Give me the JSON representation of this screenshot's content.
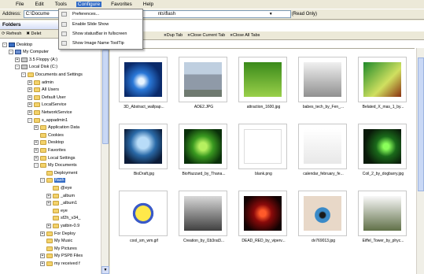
{
  "menubar": [
    "File",
    "Edit",
    "Tools",
    "Configure",
    "Favorites",
    "Help"
  ],
  "address": {
    "label": "Address:",
    "value_left": "C:\\Docume",
    "value_right": "nts\\flash",
    "readonly": "(Read Only)"
  },
  "left_panel": {
    "title": "Folders",
    "refresh": "Refresh",
    "delete": "Delet"
  },
  "tree": [
    {
      "label": "Desktop",
      "icon": "desktop"
    },
    {
      "label": "My Computer",
      "icon": "computer"
    },
    {
      "label": "3.5 Floppy (A:)",
      "icon": "drive"
    },
    {
      "label": "Local Disk (C:)",
      "icon": "drive"
    },
    {
      "label": "Documents and Settings",
      "icon": "folder"
    },
    {
      "label": "admin",
      "icon": "folder"
    },
    {
      "label": "All Users",
      "icon": "folder"
    },
    {
      "label": "Default User",
      "icon": "folder"
    },
    {
      "label": "LocalService",
      "icon": "folder"
    },
    {
      "label": "NetworkService",
      "icon": "folder"
    },
    {
      "label": "s_appadmin1",
      "icon": "folder"
    },
    {
      "label": "Application Data",
      "icon": "folder"
    },
    {
      "label": "Cookies",
      "icon": "folder"
    },
    {
      "label": "Desktop",
      "icon": "folder"
    },
    {
      "label": "Favorites",
      "icon": "folder"
    },
    {
      "label": "Local Settings",
      "icon": "folder"
    },
    {
      "label": "My Documents",
      "icon": "folder"
    },
    {
      "label": "Deployment",
      "icon": "folder"
    },
    {
      "label": "flash",
      "icon": "folder"
    },
    {
      "label": "@eye",
      "icon": "folder"
    },
    {
      "label": "_album",
      "icon": "folder"
    },
    {
      "label": "_album1",
      "icon": "folder"
    },
    {
      "label": "eye",
      "icon": "folder"
    },
    {
      "label": "sf2h_v34_",
      "icon": "folder"
    },
    {
      "label": "yatbin-0.9",
      "icon": "folder"
    },
    {
      "label": "For Deploy",
      "icon": "folder"
    },
    {
      "label": "My Music",
      "icon": "folder"
    },
    {
      "label": "My Pictures",
      "icon": "folder"
    },
    {
      "label": "My PSP8 Files",
      "icon": "folder"
    },
    {
      "label": "my received f",
      "icon": "folder"
    }
  ],
  "configure_menu": [
    "Preferences...",
    "Enable Slide Show",
    "Show statusBar in fullscreen",
    "Show Image Name ToolTip"
  ],
  "tabs": {
    "duplicate": "Dup Tab",
    "close_current": "Close Current Tab",
    "close_all": "Close All Tabs",
    "active": "flash"
  },
  "thumbnails": [
    "3D_Abstract_wallpap...",
    "ADE2.JPG",
    "attraction_1600.jpg",
    "babes_tech_by_Fen_...",
    "Belated_X_mas_1_by...",
    "BioDraft.jpg",
    "BioHazzard_by_Thana...",
    "blank.png",
    "calendar_february_fe...",
    "Coil_2_by_dogbarry.jpg",
    "cool_sm_wm.gif",
    "Creation_by_l1b3rat3...",
    "DEAD_RED_by_viperv...",
    "dv769013.jpg",
    "Eiffel_Tower_by_phyc..."
  ],
  "colors": {
    "selection": "#316ac5",
    "chrome": "#ece9d8"
  }
}
